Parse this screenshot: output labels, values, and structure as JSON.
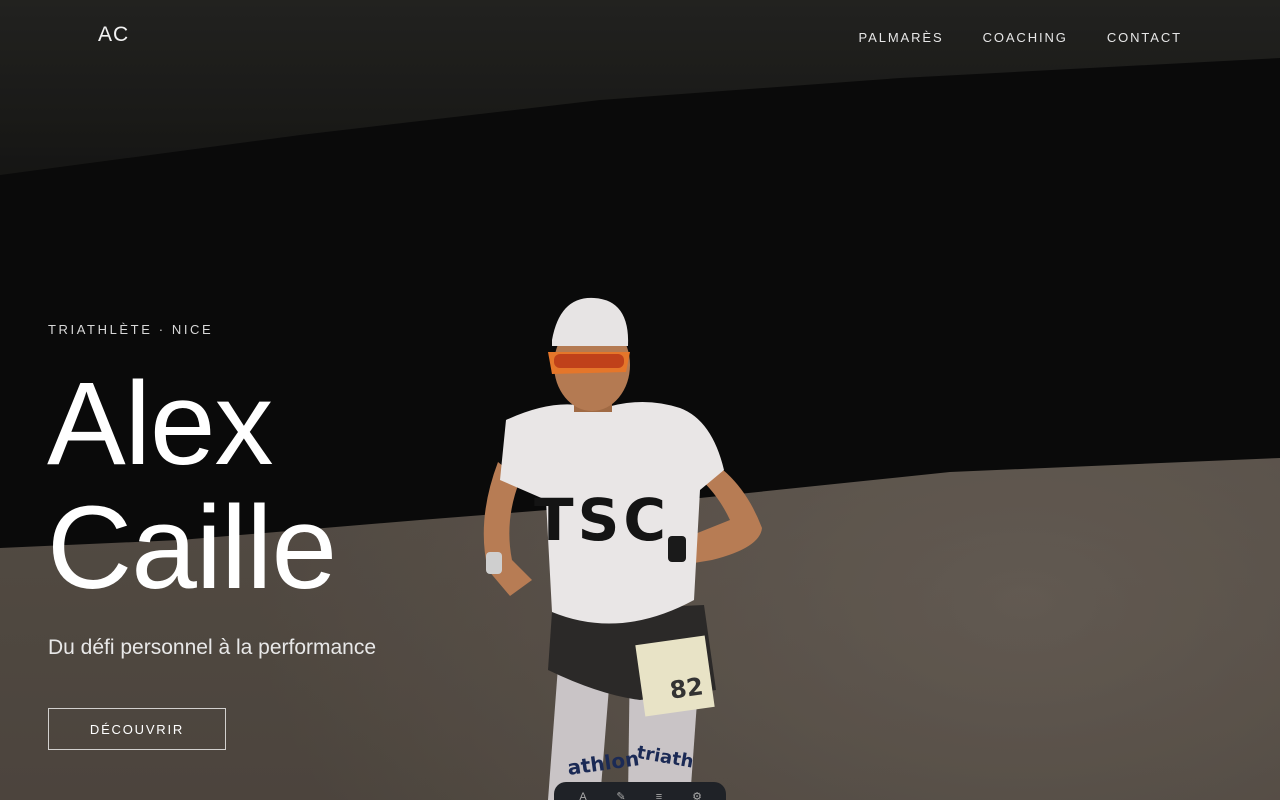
{
  "header": {
    "logo": "AC",
    "nav": [
      {
        "label": "PALMARÈS"
      },
      {
        "label": "COACHING"
      },
      {
        "label": "CONTACT"
      }
    ]
  },
  "hero": {
    "eyebrow": "TRIATHLÈTE · NICE",
    "title_line1": "Alex",
    "title_line2": "Caille",
    "subtitle": "Du défi personnel à la performance",
    "cta_label": "DÉCOUVRIR"
  },
  "jersey": {
    "text": "TSC",
    "bib": "82",
    "sleeve_text_left": "athlon",
    "sleeve_text_right": "triath"
  },
  "toolbar": {
    "icons": [
      "text-icon",
      "highlight-icon",
      "list-icon",
      "gear-icon"
    ]
  }
}
